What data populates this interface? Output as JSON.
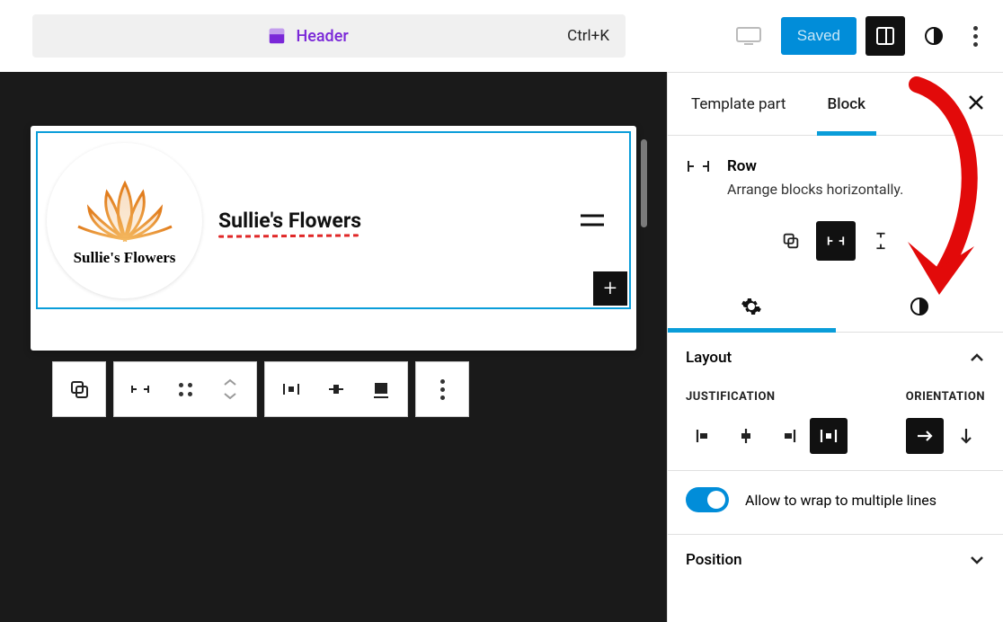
{
  "topbar": {
    "template_label": "Header",
    "shortcut": "Ctrl+K",
    "save_label": "Saved"
  },
  "canvas": {
    "site_title": "Sullie's Flowers",
    "logo_caption": "Sullie's Flowers"
  },
  "sidebar": {
    "tabs": {
      "template_part": "Template part",
      "block": "Block"
    },
    "block_name": "Row",
    "block_desc": "Arrange blocks horizontally.",
    "panels": {
      "layout": {
        "title": "Layout",
        "justification_label": "Justification",
        "orientation_label": "Orientation",
        "wrap_label": "Allow to wrap to multiple lines"
      },
      "position": {
        "title": "Position"
      }
    }
  }
}
